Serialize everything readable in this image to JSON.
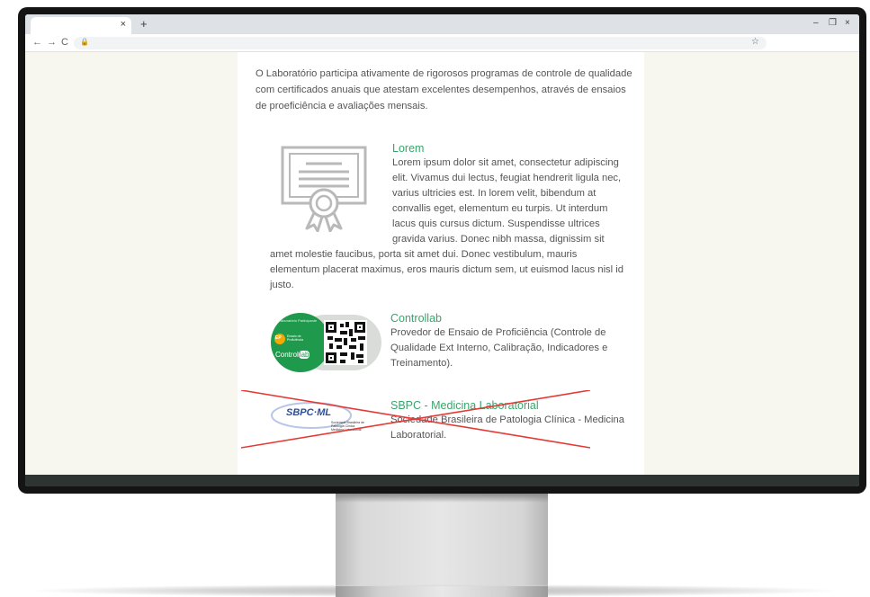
{
  "browser": {
    "tab_close": "×",
    "new_tab": "+",
    "back": "←",
    "forward": "→",
    "reload": "C",
    "lock": "🔒",
    "bookmark": "☆",
    "minimize": "–",
    "restore": "❐",
    "close": "×"
  },
  "intro": "O Laboratório participa ativamente de rigorosos programas de controle de qualidade com certificados anuais que atestam excelentes desempenhos, através de ensaios de proeficiência e avaliações mensais.",
  "lorem": {
    "title": "Lorem",
    "text": "Lorem ipsum dolor sit amet, consectetur adipiscing elit. Vivamus dui lectus, feugiat hendrerit ligula nec, varius ultricies est. In lorem velit, bibendum at convallis eget, elementum eu turpis. Ut interdum lacus quis cursus dictum. Suspendisse ultrices gravida varius. Donec nibh massa, dignissim sit amet molestie faucibus, porta sit amet dui. Donec vestibulum, mauris elementum placerat maximus, eros mauris dictum sem, ut euismod lacus nisl id justo."
  },
  "controllab": {
    "title": "Controllab",
    "text": "Provedor de Ensaio de Proficiência (Controle de Qualidade Ext Interno, Calibração, Indicadores e Treinamento).",
    "logo_ring": "Laboratório Participante",
    "logo_ep": "EP",
    "logo_ep_label": "Ensaio de Proficiência",
    "logo_brand": "Control",
    "logo_brand_suffix": "lab"
  },
  "sbpc": {
    "title": "SBPC - Medicina Laboratorial",
    "text": "Sociedade Brasileira de Patologia Clínica - Medicina Laboratorial.",
    "logo_mark": "SBPC",
    "logo_mark2": "ML",
    "logo_sub": "Sociedade Brasileira de Patologia Clínica Medicina Laboratorial"
  },
  "colors": {
    "accent": "#3aa56b",
    "text": "#555555",
    "strike": "#e53935",
    "page_bg": "#f7f7f0",
    "footer": "#2e3431"
  },
  "icons": [
    "certificate-icon",
    "search-lock-icon",
    "star-icon"
  ]
}
